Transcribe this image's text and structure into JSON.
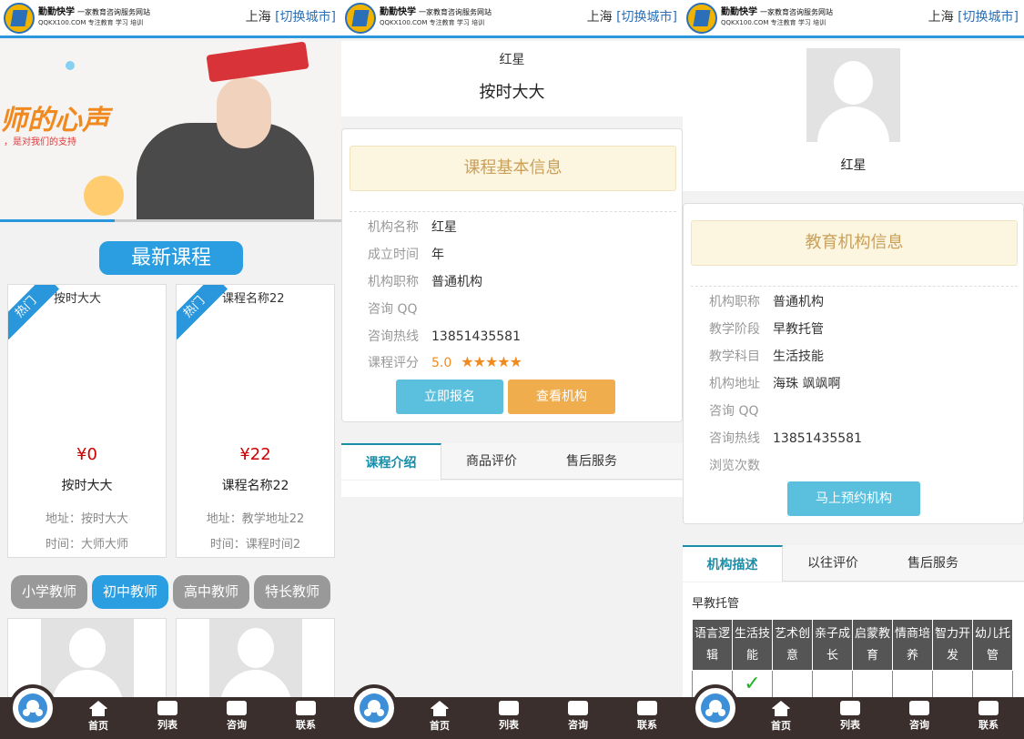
{
  "header": {
    "brand": "勤勤快学",
    "slogan": "一家教育咨询服务网站",
    "domain_line": "QQKX100.COM 专注教育 学习 培训",
    "city": "上海",
    "switch_city": "[切换城市]"
  },
  "footer": {
    "items": [
      {
        "label": "首页",
        "icon": "home-icon"
      },
      {
        "label": "列表",
        "icon": "list-icon"
      },
      {
        "label": "咨询",
        "icon": "chat-icon"
      },
      {
        "label": "联系",
        "icon": "contact-icon"
      }
    ]
  },
  "home": {
    "banner": {
      "headline": "师的心声",
      "subline": "，是对我们的支持"
    },
    "section_title": "最新课程",
    "courses": [
      {
        "badge": "热门",
        "image_alt": "按时大大",
        "price": "¥0",
        "name": "按时大大",
        "address": "地址：按时大大",
        "time": "时间：大师大师"
      },
      {
        "badge": "热门",
        "image_alt": "课程名称22",
        "price": "¥22",
        "name": "课程名称22",
        "address": "地址：教学地址22",
        "time": "时间：课程时间2"
      }
    ],
    "teacher_tabs": [
      "小学教师",
      "初中教师",
      "高中教师",
      "特长教师"
    ],
    "active_teacher_tab": "初中教师"
  },
  "course_detail": {
    "image_alt": "红星",
    "title": "按时大大",
    "info_header": "课程基本信息",
    "rows": [
      {
        "label": "机构名称",
        "value": "红星"
      },
      {
        "label": "成立时间",
        "value": "年"
      },
      {
        "label": "机构职称",
        "value": "普通机构"
      },
      {
        "label": "咨询 QQ",
        "value": ""
      },
      {
        "label": "咨询热线",
        "value": "13851435581"
      }
    ],
    "rating_label": "课程评分",
    "rating_value": "5.0",
    "stars": "★★★★★",
    "btn_enroll": "立即报名",
    "btn_view_org": "查看机构",
    "tabs": [
      "课程介绍",
      "商品评价",
      "售后服务"
    ]
  },
  "org_detail": {
    "name": "红星",
    "info_header": "教育机构信息",
    "rows": [
      {
        "label": "机构职称",
        "value": "普通机构"
      },
      {
        "label": "教学阶段",
        "value": "早教托管"
      },
      {
        "label": "教学科目",
        "value": "生活技能"
      },
      {
        "label": "机构地址",
        "value": "海珠 飒飒啊"
      },
      {
        "label": "咨询 QQ",
        "value": ""
      },
      {
        "label": "咨询热线",
        "value": "13851435581"
      },
      {
        "label": "浏览次数",
        "value": ""
      }
    ],
    "btn_book": "马上预约机构",
    "tabs": [
      "机构描述",
      "以往评价",
      "售后服务"
    ],
    "description": "早教托管",
    "table_headers": [
      "语言逻辑",
      "生活技能",
      "艺术创意",
      "亲子成长",
      "启蒙教育",
      "情商培养",
      "智力开发",
      "幼儿托管"
    ],
    "table_checks": [
      "",
      "✓",
      "",
      "",
      "",
      "",
      "",
      ""
    ]
  },
  "colors": {
    "accent": "#2a96dc",
    "footer": "#3a2f2c",
    "price": "#cc0000",
    "star": "#f08a20"
  }
}
